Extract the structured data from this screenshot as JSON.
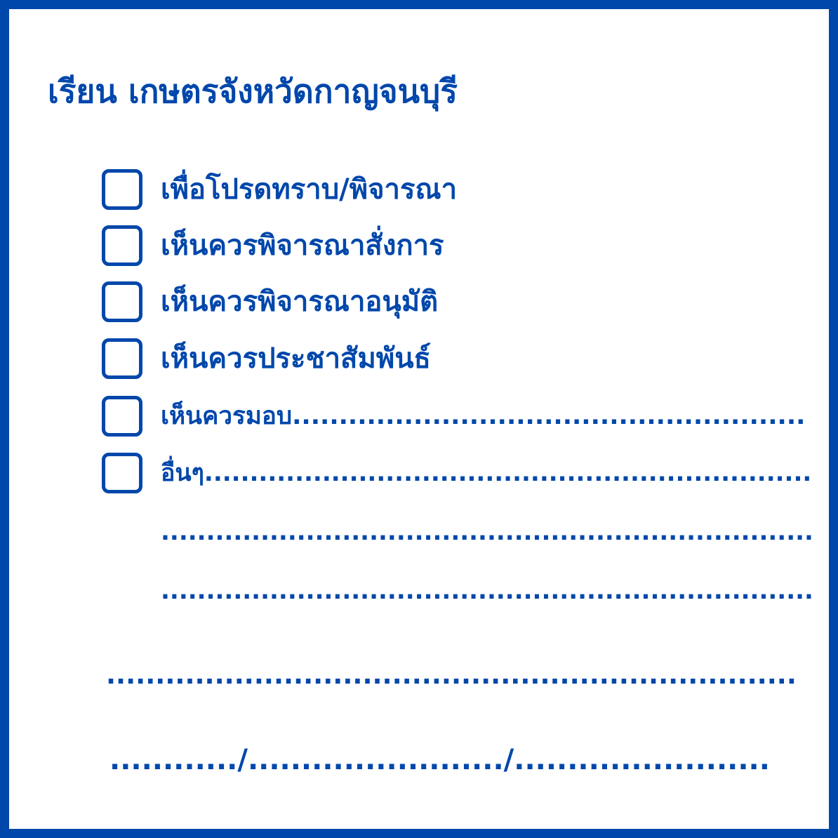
{
  "heading": "เรียน เกษตรจังหวัดกาญจนบุรี",
  "options": [
    {
      "label": "เพื่อโปรดทราบ/พิจารณา"
    },
    {
      "label": "เห็นควรพิจารณาสั่งการ"
    },
    {
      "label": "เห็นควรพิจารณาอนุมัติ"
    },
    {
      "label": "เห็นควรประชาสัมพันธ์"
    },
    {
      "label": "เห็นควรมอบ......................................................."
    },
    {
      "label": "อื่นๆ..................................................................."
    }
  ],
  "extra_lines": [
    "........................................................................",
    "........................................................................"
  ],
  "signature_line": "......................................................................",
  "date_line": "............/......................../........................",
  "colors": {
    "accent": "#0047ab"
  }
}
